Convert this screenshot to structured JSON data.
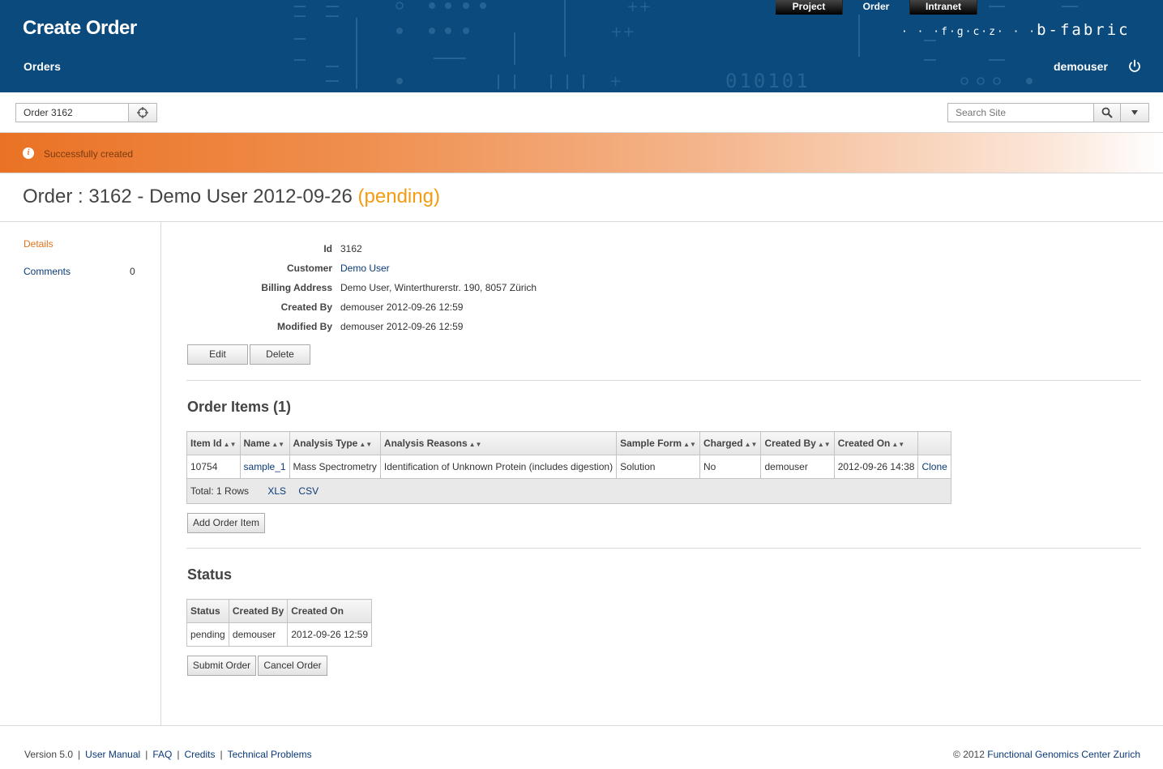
{
  "header": {
    "title": "Create Order",
    "subtitle": "Orders",
    "brand_small": "· · ·f·g·c·z· · ·",
    "brand_big": "b-fabric",
    "deco_number": "010101",
    "username": "demouser",
    "topnav": [
      "Project",
      "Order",
      "Intranet"
    ],
    "topnav_active": "Order"
  },
  "toolbar": {
    "order_value": "Order 3162",
    "search_placeholder": "Search Site"
  },
  "notice": {
    "message": "Successfully created"
  },
  "page": {
    "title_prefix": "Order : 3162 - Demo User 2012-09-26",
    "title_status": "(pending)"
  },
  "sidebar": {
    "details": "Details",
    "comments": "Comments",
    "comments_count": "0"
  },
  "details": {
    "fields": [
      {
        "label": "Id",
        "value": "3162"
      },
      {
        "label": "Customer",
        "value": "Demo User"
      },
      {
        "label": "Billing Address",
        "value": "Demo User, Winterthurerstr. 190, 8057 Zürich"
      },
      {
        "label": "Created By",
        "value": "demouser 2012-09-26 12:59"
      },
      {
        "label": "Modified By",
        "value": "demouser 2012-09-26 12:59"
      }
    ],
    "edit_label": "Edit",
    "delete_label": "Delete"
  },
  "order_items": {
    "title": "Order Items (1)",
    "columns": [
      "Item Id",
      "Name",
      "Analysis Type",
      "Analysis Reasons",
      "Sample Form",
      "Charged",
      "Created By",
      "Created On"
    ],
    "rows": [
      {
        "item_id": "10754",
        "name": "sample_1",
        "analysis_type": "Mass Spectrometry",
        "analysis_reasons": "Identification of Unknown Protein (includes digestion)",
        "sample_form": "Solution",
        "charged": "No",
        "created_by": "demouser",
        "created_on": "2012-09-26 14:38",
        "action": "Clone"
      }
    ],
    "total": "Total: 1 Rows",
    "xls": "XLS",
    "csv": "CSV",
    "add_label": "Add Order Item"
  },
  "status": {
    "title": "Status",
    "columns": [
      "Status",
      "Created By",
      "Created On"
    ],
    "rows": [
      {
        "status": "pending",
        "created_by": "demouser",
        "created_on": "2012-09-26 12:59"
      }
    ],
    "submit_label": "Submit Order",
    "cancel_label": "Cancel Order"
  },
  "footer": {
    "version": "Version 5.0",
    "links": [
      "User Manual",
      "FAQ",
      "Credits",
      "Technical Problems"
    ],
    "copyright_prefix": "© 2012",
    "copyright_link": "Functional Genomics Center Zurich"
  }
}
